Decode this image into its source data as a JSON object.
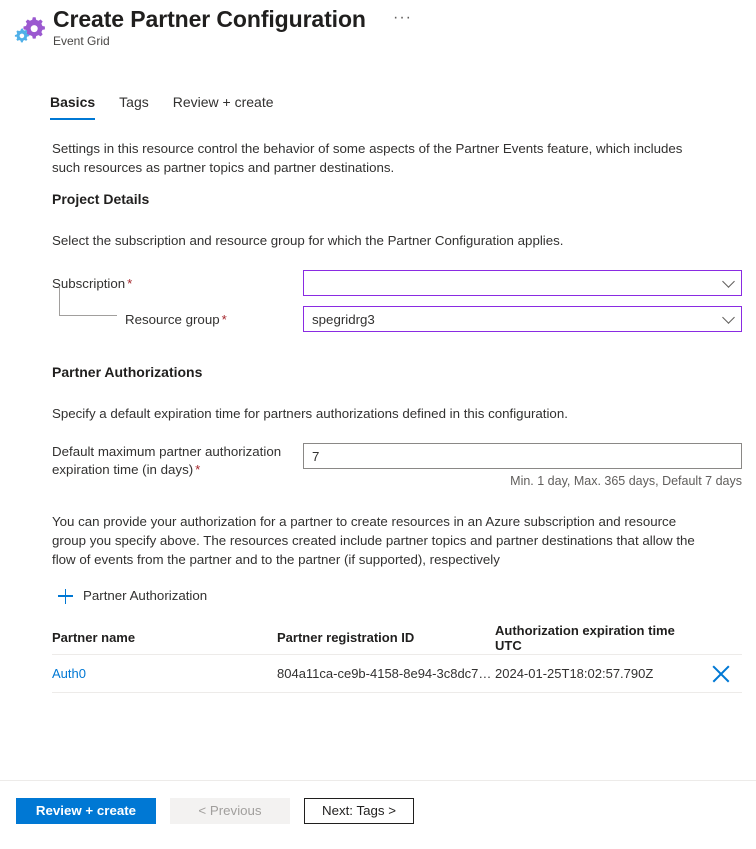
{
  "header": {
    "icon": "event-grid-gears-icon",
    "title": "Create Partner Configuration",
    "subtitle": "Event Grid",
    "ellipsis": "···"
  },
  "tabs": [
    {
      "label": "Basics",
      "active": true
    },
    {
      "label": "Tags",
      "active": false
    },
    {
      "label": "Review + create",
      "active": false
    }
  ],
  "intro": "Settings in this resource control the behavior of some aspects of the Partner Events feature, which includes such resources as partner topics and partner destinations.",
  "project_details": {
    "heading": "Project Details",
    "description": "Select the subscription and resource group for which the Partner Configuration applies.",
    "subscription": {
      "label": "Subscription",
      "required": "*",
      "value": "",
      "chevron": "chevron-down-icon"
    },
    "resource_group": {
      "label": "Resource group",
      "required": "*",
      "value": "spegridrg3",
      "chevron": "chevron-down-icon"
    }
  },
  "partner_authorizations": {
    "heading": "Partner Authorizations",
    "description": "Specify a default expiration time for partners authorizations defined in this configuration.",
    "expiration": {
      "label_line1": "Default maximum partner authorization",
      "label_line2": "expiration time (in days)",
      "required": "*",
      "value": "7",
      "hint": "Min. 1 day, Max. 365 days, Default 7 days"
    },
    "note": "You can provide your authorization for a partner to create resources in an Azure subscription and resource group you specify above. The resources created include partner topics and partner destinations that allow the flow of events from the partner and to the partner (if supported), respectively",
    "add_link": {
      "icon": "plus-icon",
      "label": "Partner Authorization"
    },
    "table": {
      "columns": [
        "Partner name",
        "Partner registration ID",
        "Authorization expiration time UTC"
      ],
      "rows": [
        {
          "partner_name": "Auth0",
          "registration_id": "804a11ca-ce9b-4158-8e94-3c8dc7…",
          "expiration_time": "2024-01-25T18:02:57.790Z",
          "delete_icon": "close-icon"
        }
      ]
    }
  },
  "footer": {
    "review_create": "Review + create",
    "previous": "< Previous",
    "next": "Next: Tags >"
  },
  "colors": {
    "accent_blue": "#0078d4",
    "focus_purple": "#8a2be2",
    "required_red": "#a4262c",
    "icon_purple": "#9b59d0",
    "icon_blue": "#50b0e8"
  }
}
